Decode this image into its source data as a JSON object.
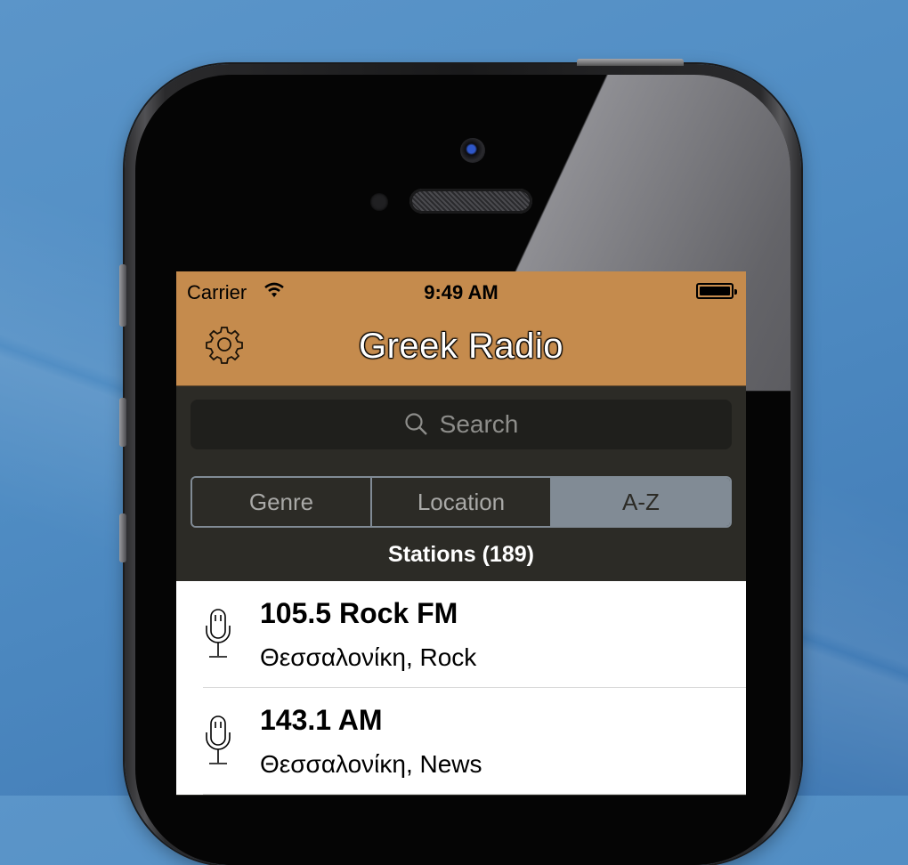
{
  "status_bar": {
    "carrier": "Carrier",
    "time": "9:49 AM"
  },
  "nav": {
    "title": "Greek Radio",
    "settings_icon": "gear-icon"
  },
  "search": {
    "placeholder": "Search"
  },
  "segments": [
    {
      "label": "Genre",
      "active": false
    },
    {
      "label": "Location",
      "active": false
    },
    {
      "label": "A-Z",
      "active": true
    }
  ],
  "section": {
    "header": "Stations (189)"
  },
  "stations": [
    {
      "name": "105.5 Rock FM",
      "subtitle": "Θεσσαλονίκη, Rock",
      "icon": "microphone-icon"
    },
    {
      "name": "143.1 AM",
      "subtitle": "Θεσσαλονίκη, News",
      "icon": "microphone-icon"
    }
  ],
  "colors": {
    "accent": "#c58b4d",
    "background": "#2c2b26",
    "segment": "#818b95"
  }
}
